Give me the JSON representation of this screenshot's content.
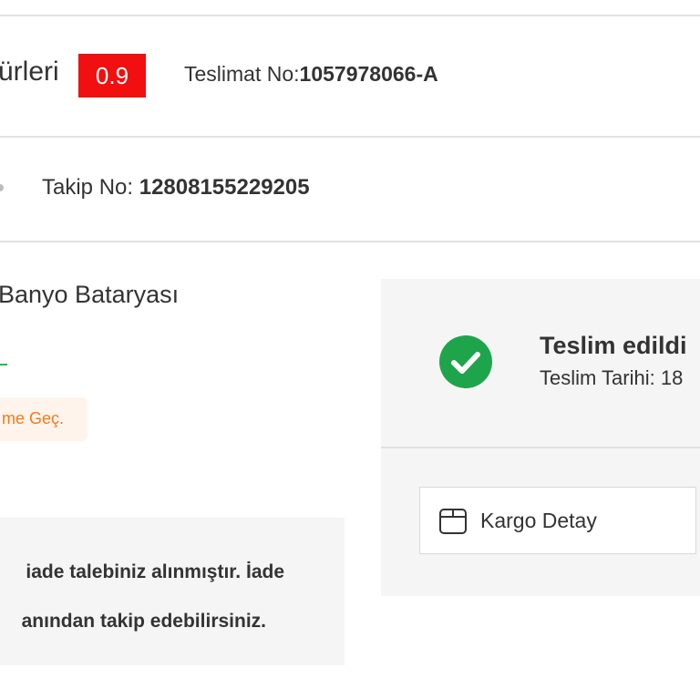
{
  "header": {
    "seller_name_partial": "ürleri",
    "seller_rating": "0.9",
    "delivery_label": "Teslimat No:",
    "delivery_number": "1057978066-A"
  },
  "shipment": {
    "tracking_label": "Takip No:",
    "tracking_number": "12808155229205"
  },
  "product": {
    "title_partial": "Banyo Bataryası",
    "promo_text_partial": "me Geç."
  },
  "return_info": {
    "line1": "iade talebiniz alınmıştır. İade",
    "line2": "anından takip edebilirsiniz."
  },
  "status": {
    "title": "Teslim edildi",
    "date_partial": "Teslim Tarihi: 18",
    "icon": "check-circle-icon",
    "icon_color": "#1ea54c"
  },
  "actions": {
    "cargo_detail_label": "Kargo Detay",
    "cargo_icon": "package-box-icon"
  },
  "colors": {
    "rating_badge": "#f10f0f",
    "promo_text": "#f27a1a",
    "promo_bg": "#fff4ec",
    "panel_bg": "#f5f5f5",
    "success": "#1ea54c"
  }
}
